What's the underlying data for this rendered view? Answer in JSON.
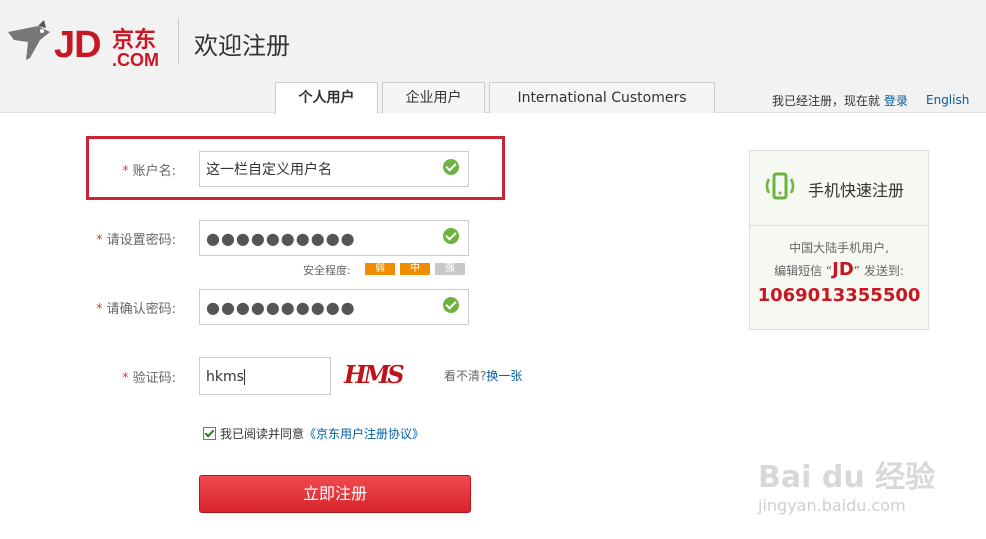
{
  "header": {
    "logo_text": "JD",
    "logo_jing": "京东",
    "logo_com": ".COM",
    "page_title": "欢迎注册",
    "tabs": [
      {
        "label": "个人用户",
        "active": true
      },
      {
        "label": "企业用户",
        "active": false
      },
      {
        "label": "International Customers",
        "active": false
      }
    ],
    "login_prefix": "我已经注册，现在就",
    "login_link": "登录",
    "language_link": "English"
  },
  "form": {
    "account": {
      "label": "账户名:",
      "value": "这一栏自定义用户名"
    },
    "password": {
      "label": "请设置密码:",
      "value": "●●●●●●●●●●"
    },
    "strength": {
      "label": "安全程度:",
      "levels": [
        "弱",
        "中",
        "强"
      ],
      "active_count": 2
    },
    "confirm": {
      "label": "请确认密码:",
      "value": "●●●●●●●●●●"
    },
    "captcha": {
      "label": "验证码:",
      "value": "hkms",
      "image_text": "HMS",
      "hint": "看不清?",
      "refresh_link": "换一张"
    },
    "agree": {
      "checked": true,
      "prefix": "我已阅读并同意",
      "link": "《京东用户注册协议》"
    },
    "submit_label": "立即注册",
    "required_mark": "*"
  },
  "mobile": {
    "title": "手机快速注册",
    "line1": "中国大陆手机用户,",
    "line2_prefix": "编辑短信 “",
    "keyword": "JD",
    "line2_suffix": "” 发送到:",
    "number": "1069013355500"
  },
  "watermark": {
    "text": "Bai du 经验",
    "url": "jingyan.baidu.com"
  },
  "colors": {
    "brand": "#c81623",
    "link": "#005ea7",
    "ok": "#6db33f",
    "strength_active": "#f08c00",
    "strength_inactive": "#c8c8c8"
  }
}
